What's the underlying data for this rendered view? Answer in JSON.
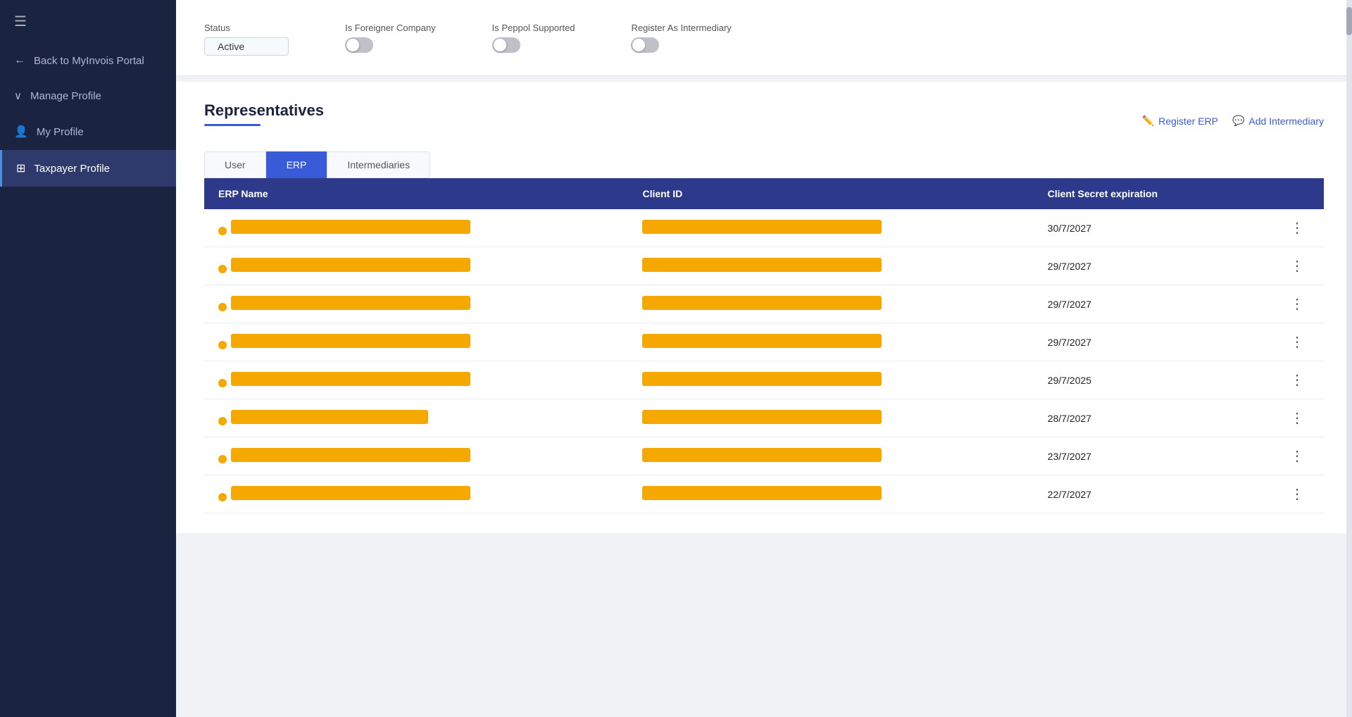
{
  "sidebar": {
    "hamburger_icon": "☰",
    "items": [
      {
        "id": "back",
        "label": "Back to MyInvois Portal",
        "icon": "←",
        "active": false
      },
      {
        "id": "manage-profile",
        "label": "Manage Profile",
        "icon": "∨",
        "active": false,
        "chevron": true
      },
      {
        "id": "my-profile",
        "label": "My Profile",
        "icon": "👤",
        "active": false
      },
      {
        "id": "taxpayer-profile",
        "label": "Taxpayer Profile",
        "icon": "⊞",
        "active": true
      }
    ]
  },
  "status_section": {
    "status_label": "Status",
    "status_value": "Active",
    "is_foreigner_label": "Is Foreigner Company",
    "is_peppol_label": "Is Peppol Supported",
    "register_intermediary_label": "Register As Intermediary"
  },
  "representatives": {
    "title": "Representatives",
    "tabs": [
      "User",
      "ERP",
      "Intermediaries"
    ],
    "active_tab": "ERP",
    "register_erp_label": "Register ERP",
    "add_intermediary_label": "Add Intermediary",
    "columns": [
      "ERP Name",
      "Client ID",
      "Client Secret expiration"
    ],
    "rows": [
      {
        "erp_name_redacted": true,
        "client_id_redacted": true,
        "expiration": "30/7/2027"
      },
      {
        "erp_name_redacted": true,
        "client_id_redacted": true,
        "expiration": "29/7/2027"
      },
      {
        "erp_name_redacted": true,
        "client_id_redacted": true,
        "expiration": "29/7/2027"
      },
      {
        "erp_name_redacted": true,
        "client_id_redacted": true,
        "expiration": "29/7/2027"
      },
      {
        "erp_name_redacted": true,
        "client_id_redacted": true,
        "expiration": "29/7/2025"
      },
      {
        "erp_name_redacted": true,
        "client_id_redacted": true,
        "expiration": "28/7/2027"
      },
      {
        "erp_name_redacted": true,
        "client_id_redacted": true,
        "expiration": "23/7/2027"
      },
      {
        "erp_name_redacted": true,
        "client_id_redacted": true,
        "expiration": "22/7/2027"
      }
    ]
  },
  "colors": {
    "sidebar_bg": "#1a2340",
    "active_sidebar": "#2d3a6b",
    "table_header": "#2d3a8c",
    "tab_active": "#3a5bd9",
    "redacted_bar": "#f5a800",
    "status_active": "#Active"
  }
}
